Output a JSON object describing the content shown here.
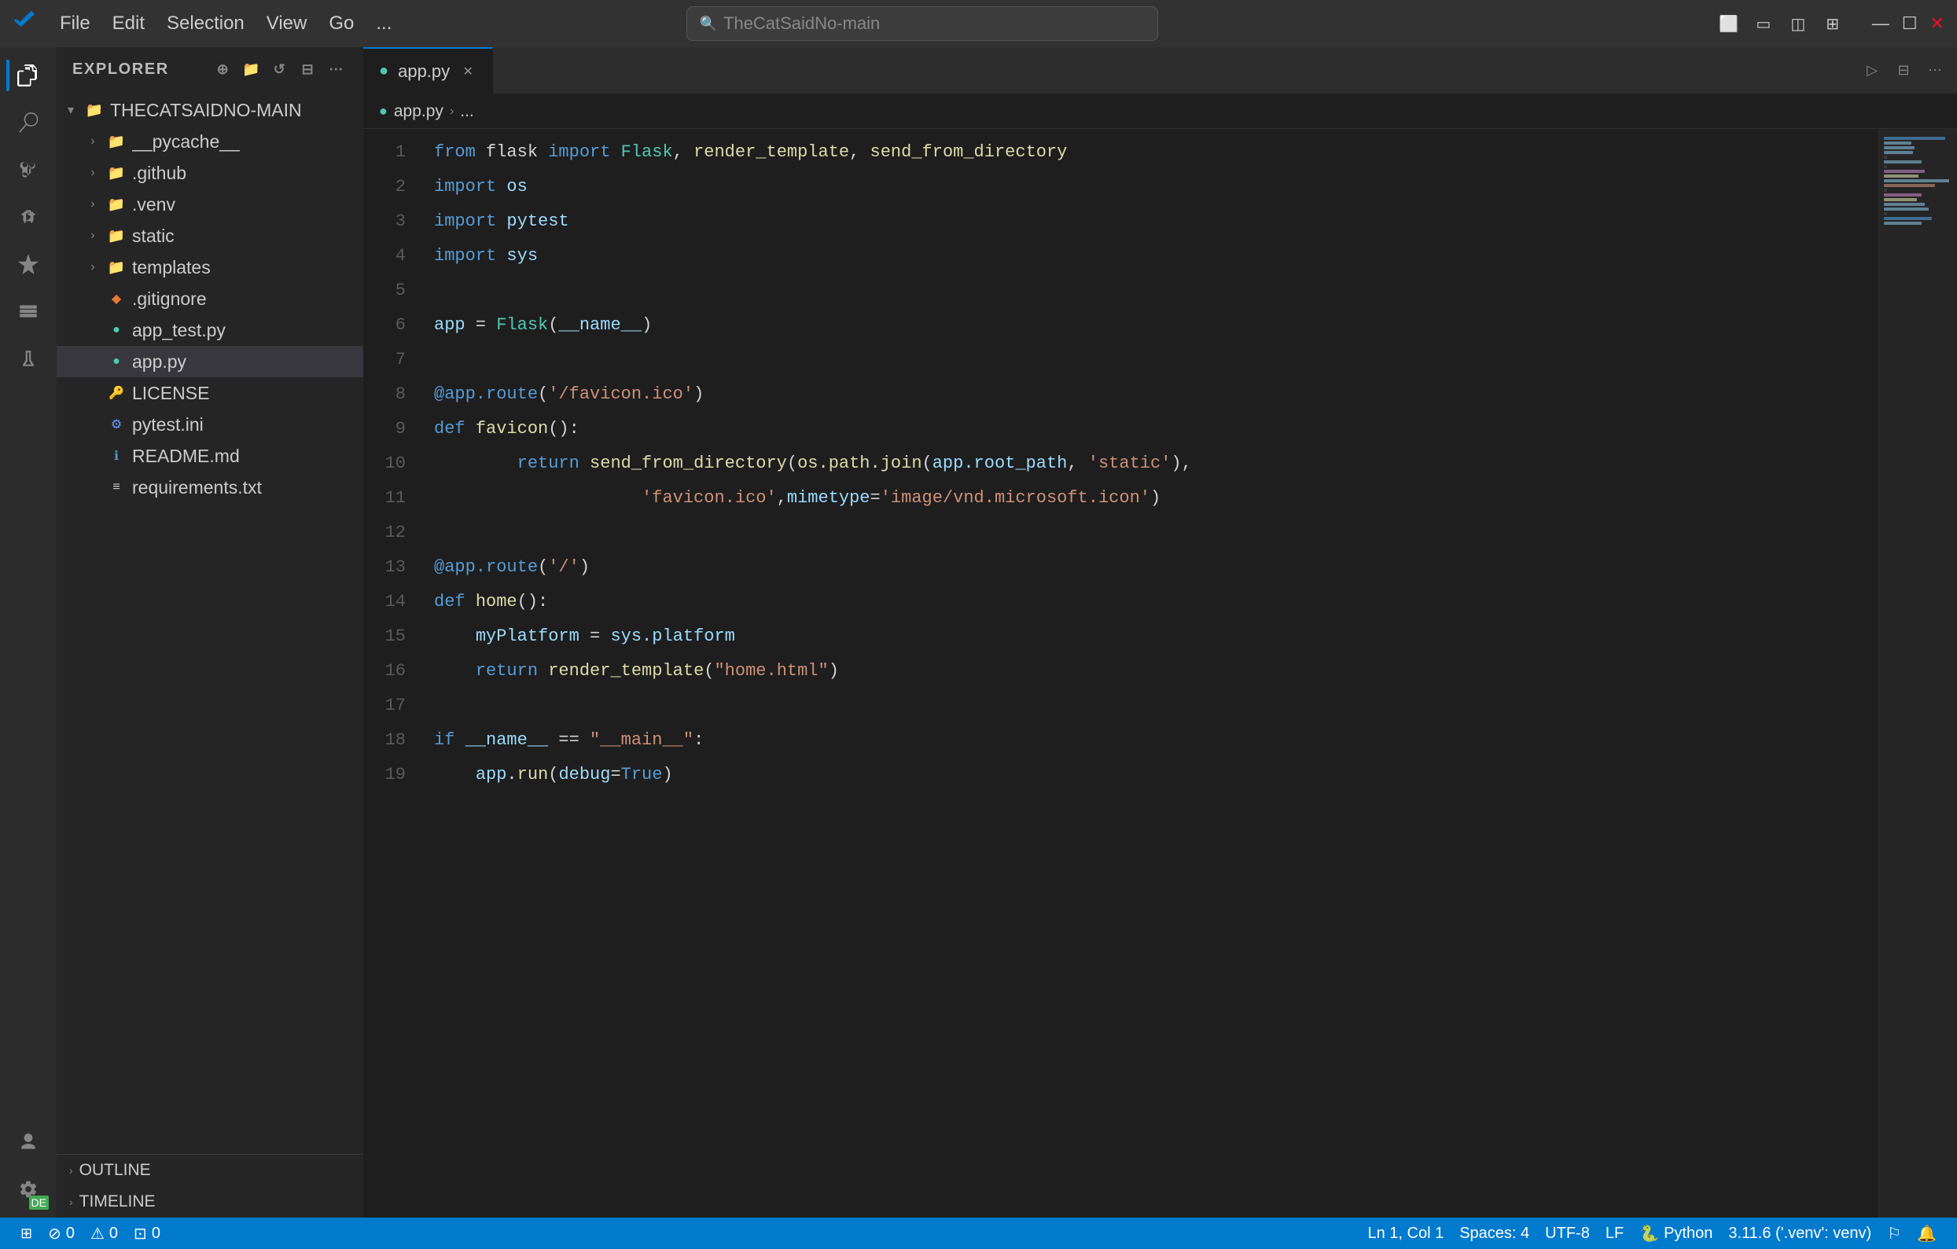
{
  "titlebar": {
    "menu_items": [
      "File",
      "Edit",
      "Selection",
      "View",
      "Go",
      "..."
    ],
    "search_placeholder": "TheCatSaidNo-main",
    "window_controls": [
      "—",
      "☐",
      "✕"
    ]
  },
  "activity_bar": {
    "items": [
      {
        "name": "explorer",
        "icon": "⎘",
        "active": true
      },
      {
        "name": "search",
        "icon": "🔍",
        "active": false
      },
      {
        "name": "source-control",
        "icon": "⎇",
        "active": false
      },
      {
        "name": "run-debug",
        "icon": "▷",
        "active": false
      },
      {
        "name": "extensions",
        "icon": "⊞",
        "active": false
      },
      {
        "name": "remote-explorer",
        "icon": "⊡",
        "active": false
      },
      {
        "name": "testing",
        "icon": "⚗",
        "active": false
      }
    ],
    "bottom": [
      {
        "name": "account",
        "icon": "👤"
      },
      {
        "name": "settings",
        "icon": "⚙",
        "badge": "DE"
      }
    ]
  },
  "sidebar": {
    "title": "EXPLORER",
    "root_folder": "THECATSAIDNO-MAIN",
    "files": [
      {
        "id": "pycache",
        "label": "__pycache__",
        "type": "folder",
        "indent": 1,
        "collapsed": true
      },
      {
        "id": "github",
        "label": ".github",
        "type": "folder",
        "indent": 1,
        "collapsed": true
      },
      {
        "id": "venv",
        "label": ".venv",
        "type": "folder",
        "indent": 1,
        "collapsed": true
      },
      {
        "id": "static",
        "label": "static",
        "type": "folder",
        "indent": 1,
        "collapsed": true
      },
      {
        "id": "templates",
        "label": "templates",
        "type": "folder",
        "indent": 1,
        "collapsed": true
      },
      {
        "id": "gitignore",
        "label": ".gitignore",
        "type": "git",
        "indent": 1
      },
      {
        "id": "app_test",
        "label": "app_test.py",
        "type": "py",
        "indent": 1
      },
      {
        "id": "app_py",
        "label": "app.py",
        "type": "py",
        "indent": 1,
        "selected": true
      },
      {
        "id": "license",
        "label": "LICENSE",
        "type": "license",
        "indent": 1
      },
      {
        "id": "pytest_ini",
        "label": "pytest.ini",
        "type": "ini",
        "indent": 1
      },
      {
        "id": "readme",
        "label": "README.md",
        "type": "md",
        "indent": 1
      },
      {
        "id": "requirements",
        "label": "requirements.txt",
        "type": "txt",
        "indent": 1
      }
    ],
    "outline_label": "OUTLINE",
    "timeline_label": "TIMELINE"
  },
  "editor": {
    "tab_label": "app.py",
    "breadcrumb_file": "app.py",
    "breadcrumb_sep": "›",
    "breadcrumb_rest": "...",
    "lines": [
      {
        "num": 1,
        "tokens": [
          {
            "t": "from ",
            "c": "kw2"
          },
          {
            "t": "flask ",
            "c": "plain"
          },
          {
            "t": "import ",
            "c": "kw2"
          },
          {
            "t": "Flask",
            "c": "cls"
          },
          {
            "t": ", ",
            "c": "plain"
          },
          {
            "t": "render_template",
            "c": "fn"
          },
          {
            "t": ", ",
            "c": "plain"
          },
          {
            "t": "send_from_directory",
            "c": "fn"
          }
        ]
      },
      {
        "num": 2,
        "tokens": [
          {
            "t": "import ",
            "c": "kw2"
          },
          {
            "t": "os",
            "c": "var"
          }
        ]
      },
      {
        "num": 3,
        "tokens": [
          {
            "t": "import ",
            "c": "kw2"
          },
          {
            "t": "pytest",
            "c": "var"
          }
        ]
      },
      {
        "num": 4,
        "tokens": [
          {
            "t": "import ",
            "c": "kw2"
          },
          {
            "t": "sys",
            "c": "var"
          }
        ]
      },
      {
        "num": 5,
        "tokens": []
      },
      {
        "num": 6,
        "tokens": [
          {
            "t": "app",
            "c": "var"
          },
          {
            "t": " = ",
            "c": "plain"
          },
          {
            "t": "Flask",
            "c": "cls"
          },
          {
            "t": "(",
            "c": "plain"
          },
          {
            "t": "__name__",
            "c": "var"
          },
          {
            "t": ")",
            "c": "plain"
          }
        ]
      },
      {
        "num": 7,
        "tokens": []
      },
      {
        "num": 8,
        "tokens": [
          {
            "t": "@app.route",
            "c": "deco"
          },
          {
            "t": "(",
            "c": "plain"
          },
          {
            "t": "'/favicon.ico'",
            "c": "str"
          },
          {
            "t": ")",
            "c": "plain"
          }
        ]
      },
      {
        "num": 9,
        "tokens": [
          {
            "t": "def ",
            "c": "kw2"
          },
          {
            "t": "favicon",
            "c": "fn"
          },
          {
            "t": "():",
            "c": "plain"
          }
        ]
      },
      {
        "num": 10,
        "tokens": [
          {
            "t": "        return ",
            "c": "kw2"
          },
          {
            "t": "send_from_directory",
            "c": "fn"
          },
          {
            "t": "(",
            "c": "plain"
          },
          {
            "t": "os.path.join",
            "c": "fn"
          },
          {
            "t": "(",
            "c": "plain"
          },
          {
            "t": "app.root_path",
            "c": "var"
          },
          {
            "t": ", ",
            "c": "plain"
          },
          {
            "t": "'static'",
            "c": "str"
          },
          {
            "t": "),",
            "c": "plain"
          }
        ]
      },
      {
        "num": 11,
        "tokens": [
          {
            "t": "                    ",
            "c": "plain"
          },
          {
            "t": "'favicon.ico'",
            "c": "str"
          },
          {
            "t": ",",
            "c": "plain"
          },
          {
            "t": "mimetype",
            "c": "param"
          },
          {
            "t": "=",
            "c": "plain"
          },
          {
            "t": "'image/vnd.microsoft.icon'",
            "c": "str"
          },
          {
            "t": ")",
            "c": "plain"
          }
        ]
      },
      {
        "num": 12,
        "tokens": []
      },
      {
        "num": 13,
        "tokens": [
          {
            "t": "@app.route",
            "c": "deco"
          },
          {
            "t": "(",
            "c": "plain"
          },
          {
            "t": "'/'",
            "c": "str"
          },
          {
            "t": ")",
            "c": "plain"
          }
        ]
      },
      {
        "num": 14,
        "tokens": [
          {
            "t": "def ",
            "c": "kw2"
          },
          {
            "t": "home",
            "c": "fn"
          },
          {
            "t": "():",
            "c": "plain"
          }
        ]
      },
      {
        "num": 15,
        "tokens": [
          {
            "t": "    ",
            "c": "plain"
          },
          {
            "t": "myPlatform",
            "c": "var"
          },
          {
            "t": " = ",
            "c": "plain"
          },
          {
            "t": "sys.platform",
            "c": "var"
          }
        ]
      },
      {
        "num": 16,
        "tokens": [
          {
            "t": "    return ",
            "c": "kw2"
          },
          {
            "t": "render_template",
            "c": "fn"
          },
          {
            "t": "(",
            "c": "plain"
          },
          {
            "t": "\"home.html\"",
            "c": "str"
          },
          {
            "t": ")",
            "c": "plain"
          }
        ]
      },
      {
        "num": 17,
        "tokens": []
      },
      {
        "num": 18,
        "tokens": [
          {
            "t": "if ",
            "c": "kw2"
          },
          {
            "t": "__name__",
            "c": "var"
          },
          {
            "t": " == ",
            "c": "plain"
          },
          {
            "t": "\"__main__\"",
            "c": "str"
          },
          {
            "t": ":",
            "c": "plain"
          }
        ]
      },
      {
        "num": 19,
        "tokens": [
          {
            "t": "    ",
            "c": "plain"
          },
          {
            "t": "app",
            "c": "var"
          },
          {
            "t": ".",
            "c": "plain"
          },
          {
            "t": "run",
            "c": "fn"
          },
          {
            "t": "(",
            "c": "plain"
          },
          {
            "t": "debug",
            "c": "param"
          },
          {
            "t": "=",
            "c": "plain"
          },
          {
            "t": "True",
            "c": "bool"
          },
          {
            "t": ")",
            "c": "plain"
          }
        ]
      }
    ]
  },
  "status_bar": {
    "left": [
      {
        "id": "remote",
        "icon": "⊞",
        "text": ""
      },
      {
        "id": "errors",
        "icon": "⊘",
        "text": "0"
      },
      {
        "id": "warnings",
        "icon": "⚠",
        "text": "0"
      },
      {
        "id": "info",
        "icon": "⊡",
        "text": "0"
      }
    ],
    "right": [
      {
        "id": "position",
        "text": "Ln 1, Col 1"
      },
      {
        "id": "spaces",
        "text": "Spaces: 4"
      },
      {
        "id": "encoding",
        "text": "UTF-8"
      },
      {
        "id": "line-ending",
        "text": "LF"
      },
      {
        "id": "language",
        "icon": "🐍",
        "text": "Python"
      },
      {
        "id": "version",
        "text": "3.11.6 ('.venv': venv)"
      },
      {
        "id": "feedback",
        "icon": "⚐",
        "text": ""
      },
      {
        "id": "notifications",
        "icon": "🔔",
        "text": ""
      }
    ]
  }
}
